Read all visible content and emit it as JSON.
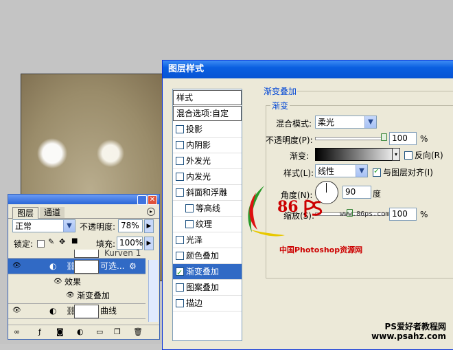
{
  "dialog": {
    "title": "图层样式",
    "styles_header": "样式",
    "blend_options": "混合选项:自定",
    "styles": [
      {
        "label": "投影",
        "checked": false,
        "indent": false,
        "selected": false
      },
      {
        "label": "内阴影",
        "checked": false,
        "indent": false,
        "selected": false
      },
      {
        "label": "外发光",
        "checked": false,
        "indent": false,
        "selected": false
      },
      {
        "label": "内发光",
        "checked": false,
        "indent": false,
        "selected": false
      },
      {
        "label": "斜面和浮雕",
        "checked": false,
        "indent": false,
        "selected": false
      },
      {
        "label": "等高线",
        "checked": false,
        "indent": true,
        "selected": false
      },
      {
        "label": "纹理",
        "checked": false,
        "indent": true,
        "selected": false
      },
      {
        "label": "光泽",
        "checked": false,
        "indent": false,
        "selected": false
      },
      {
        "label": "颜色叠加",
        "checked": false,
        "indent": false,
        "selected": false
      },
      {
        "label": "渐变叠加",
        "checked": true,
        "indent": false,
        "selected": true
      },
      {
        "label": "图案叠加",
        "checked": false,
        "indent": false,
        "selected": false
      },
      {
        "label": "描边",
        "checked": false,
        "indent": false,
        "selected": false
      }
    ],
    "section_title": "渐变叠加",
    "subsection_title": "渐变",
    "blend_mode_label": "混合模式:",
    "blend_mode_value": "柔光",
    "opacity_label": "不透明度(P):",
    "opacity_value": "100",
    "opacity_unit": "%",
    "opacity_level": 1.0,
    "gradient_label": "渐变:",
    "reverse_label": "反向(R)",
    "reverse_checked": false,
    "style_label": "样式(L):",
    "style_value": "线性",
    "align_label": "与图层对齐(I)",
    "align_checked": true,
    "angle_label": "角度(N):",
    "angle_value": "90",
    "angle_unit": "度",
    "scale_label": "缩放(S):",
    "scale_value": "100",
    "scale_unit": "%",
    "scale_level": 0.5
  },
  "logo": {
    "text86": "86",
    "url": "www.86ps.com",
    "cn": "中国Photoshop资源网"
  },
  "layers": {
    "tabs": [
      "图层",
      "通道"
    ],
    "blend_mode": "正常",
    "opacity_label": "不透明度:",
    "opacity_value": "78%",
    "lock_label": "锁定:",
    "fill_label": "填充:",
    "fill_value": "100%",
    "rows": [
      {
        "name": "Kurven 1"
      },
      {
        "name": "可选..."
      },
      {
        "name": "效果"
      },
      {
        "name": "渐变叠加"
      },
      {
        "name": "曲线"
      }
    ]
  },
  "watermark": {
    "line1": "PS爱好者教程网",
    "line2": "www.psahz.com"
  }
}
